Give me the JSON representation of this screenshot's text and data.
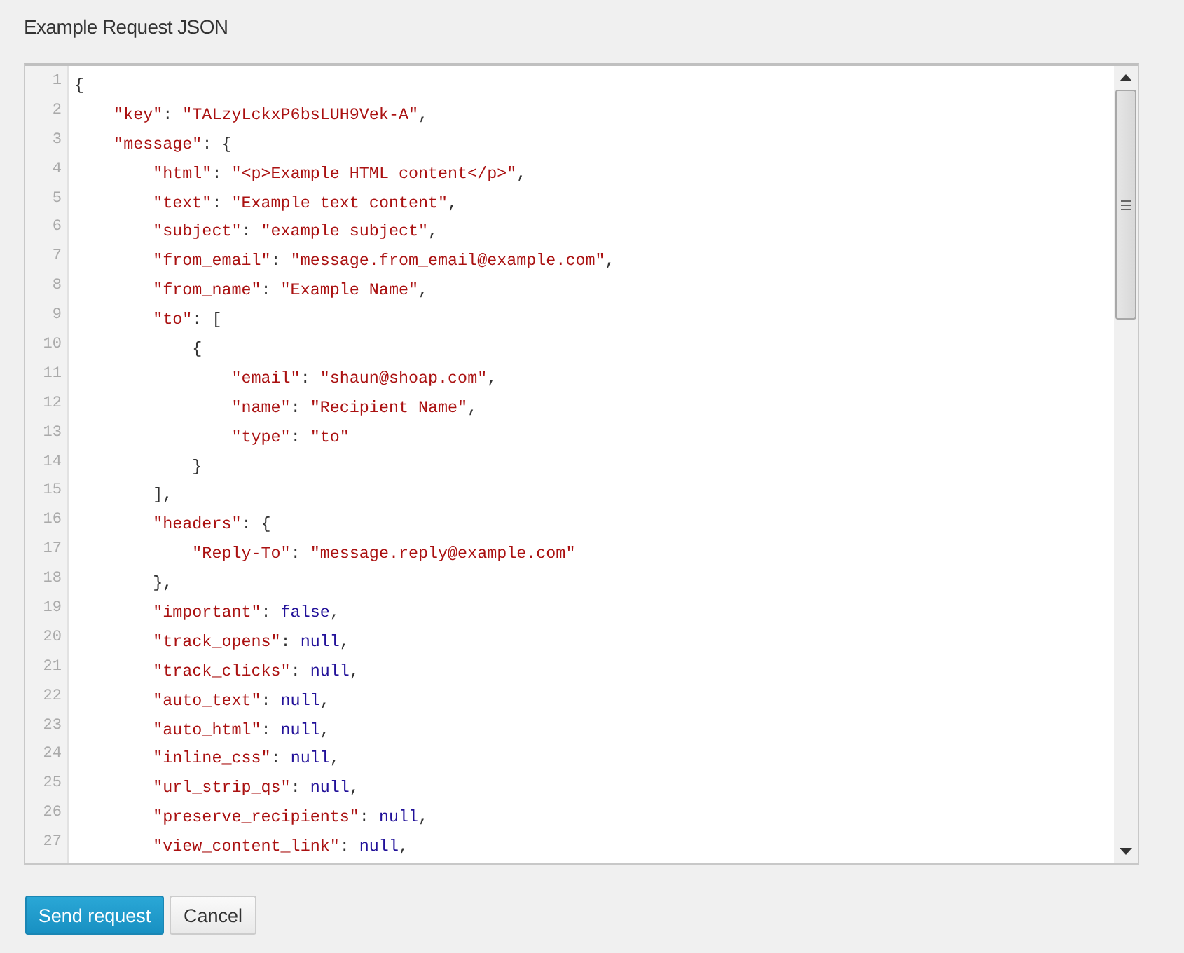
{
  "title": "Example Request JSON",
  "editor": {
    "lines": [
      {
        "number": "1",
        "tokens": [
          {
            "kind": "punct",
            "text": "{"
          }
        ]
      },
      {
        "number": "2",
        "tokens": [
          {
            "kind": "string",
            "text": "    \"key\""
          },
          {
            "kind": "punct",
            "text": ": "
          },
          {
            "kind": "string",
            "text": "\"TALzyLckxP6bsLUH9Vek-A\""
          },
          {
            "kind": "punct",
            "text": ","
          }
        ]
      },
      {
        "number": "3",
        "tokens": [
          {
            "kind": "string",
            "text": "    \"message\""
          },
          {
            "kind": "punct",
            "text": ": {"
          }
        ]
      },
      {
        "number": "4",
        "tokens": [
          {
            "kind": "string",
            "text": "        \"html\""
          },
          {
            "kind": "punct",
            "text": ": "
          },
          {
            "kind": "string",
            "text": "\"<p>Example HTML content</p>\""
          },
          {
            "kind": "punct",
            "text": ","
          }
        ]
      },
      {
        "number": "5",
        "tokens": [
          {
            "kind": "string",
            "text": "        \"text\""
          },
          {
            "kind": "punct",
            "text": ": "
          },
          {
            "kind": "string",
            "text": "\"Example text content\""
          },
          {
            "kind": "punct",
            "text": ","
          }
        ]
      },
      {
        "number": "6",
        "tokens": [
          {
            "kind": "string",
            "text": "        \"subject\""
          },
          {
            "kind": "punct",
            "text": ": "
          },
          {
            "kind": "string",
            "text": "\"example subject\""
          },
          {
            "kind": "punct",
            "text": ","
          }
        ]
      },
      {
        "number": "7",
        "tokens": [
          {
            "kind": "string",
            "text": "        \"from_email\""
          },
          {
            "kind": "punct",
            "text": ": "
          },
          {
            "kind": "string",
            "text": "\"message.from_email@example.com\""
          },
          {
            "kind": "punct",
            "text": ","
          }
        ]
      },
      {
        "number": "8",
        "tokens": [
          {
            "kind": "string",
            "text": "        \"from_name\""
          },
          {
            "kind": "punct",
            "text": ": "
          },
          {
            "kind": "string",
            "text": "\"Example Name\""
          },
          {
            "kind": "punct",
            "text": ","
          }
        ]
      },
      {
        "number": "9",
        "tokens": [
          {
            "kind": "string",
            "text": "        \"to\""
          },
          {
            "kind": "punct",
            "text": ": ["
          }
        ]
      },
      {
        "number": "10",
        "tokens": [
          {
            "kind": "punct",
            "text": "            {"
          }
        ]
      },
      {
        "number": "11",
        "tokens": [
          {
            "kind": "string",
            "text": "                \"email\""
          },
          {
            "kind": "punct",
            "text": ": "
          },
          {
            "kind": "string",
            "text": "\"shaun@shoap.com\""
          },
          {
            "kind": "punct",
            "text": ","
          }
        ]
      },
      {
        "number": "12",
        "tokens": [
          {
            "kind": "string",
            "text": "                \"name\""
          },
          {
            "kind": "punct",
            "text": ": "
          },
          {
            "kind": "string",
            "text": "\"Recipient Name\""
          },
          {
            "kind": "punct",
            "text": ","
          }
        ]
      },
      {
        "number": "13",
        "tokens": [
          {
            "kind": "string",
            "text": "                \"type\""
          },
          {
            "kind": "punct",
            "text": ": "
          },
          {
            "kind": "string",
            "text": "\"to\""
          }
        ]
      },
      {
        "number": "14",
        "tokens": [
          {
            "kind": "punct",
            "text": "            }"
          }
        ]
      },
      {
        "number": "15",
        "tokens": [
          {
            "kind": "punct",
            "text": "        ],"
          }
        ]
      },
      {
        "number": "16",
        "tokens": [
          {
            "kind": "string",
            "text": "        \"headers\""
          },
          {
            "kind": "punct",
            "text": ": {"
          }
        ]
      },
      {
        "number": "17",
        "tokens": [
          {
            "kind": "string",
            "text": "            \"Reply-To\""
          },
          {
            "kind": "punct",
            "text": ": "
          },
          {
            "kind": "string",
            "text": "\"message.reply@example.com\""
          }
        ]
      },
      {
        "number": "18",
        "tokens": [
          {
            "kind": "punct",
            "text": "        },"
          }
        ]
      },
      {
        "number": "19",
        "tokens": [
          {
            "kind": "string",
            "text": "        \"important\""
          },
          {
            "kind": "punct",
            "text": ": "
          },
          {
            "kind": "keyword",
            "text": "false"
          },
          {
            "kind": "punct",
            "text": ","
          }
        ]
      },
      {
        "number": "20",
        "tokens": [
          {
            "kind": "string",
            "text": "        \"track_opens\""
          },
          {
            "kind": "punct",
            "text": ": "
          },
          {
            "kind": "keyword",
            "text": "null"
          },
          {
            "kind": "punct",
            "text": ","
          }
        ]
      },
      {
        "number": "21",
        "tokens": [
          {
            "kind": "string",
            "text": "        \"track_clicks\""
          },
          {
            "kind": "punct",
            "text": ": "
          },
          {
            "kind": "keyword",
            "text": "null"
          },
          {
            "kind": "punct",
            "text": ","
          }
        ]
      },
      {
        "number": "22",
        "tokens": [
          {
            "kind": "string",
            "text": "        \"auto_text\""
          },
          {
            "kind": "punct",
            "text": ": "
          },
          {
            "kind": "keyword",
            "text": "null"
          },
          {
            "kind": "punct",
            "text": ","
          }
        ]
      },
      {
        "number": "23",
        "tokens": [
          {
            "kind": "string",
            "text": "        \"auto_html\""
          },
          {
            "kind": "punct",
            "text": ": "
          },
          {
            "kind": "keyword",
            "text": "null"
          },
          {
            "kind": "punct",
            "text": ","
          }
        ]
      },
      {
        "number": "24",
        "tokens": [
          {
            "kind": "string",
            "text": "        \"inline_css\""
          },
          {
            "kind": "punct",
            "text": ": "
          },
          {
            "kind": "keyword",
            "text": "null"
          },
          {
            "kind": "punct",
            "text": ","
          }
        ]
      },
      {
        "number": "25",
        "tokens": [
          {
            "kind": "string",
            "text": "        \"url_strip_qs\""
          },
          {
            "kind": "punct",
            "text": ": "
          },
          {
            "kind": "keyword",
            "text": "null"
          },
          {
            "kind": "punct",
            "text": ","
          }
        ]
      },
      {
        "number": "26",
        "tokens": [
          {
            "kind": "string",
            "text": "        \"preserve_recipients\""
          },
          {
            "kind": "punct",
            "text": ": "
          },
          {
            "kind": "keyword",
            "text": "null"
          },
          {
            "kind": "punct",
            "text": ","
          }
        ]
      },
      {
        "number": "27",
        "tokens": [
          {
            "kind": "string",
            "text": "        \"view_content_link\""
          },
          {
            "kind": "punct",
            "text": ": "
          },
          {
            "kind": "keyword",
            "text": "null"
          },
          {
            "kind": "punct",
            "text": ","
          }
        ]
      }
    ]
  },
  "buttons": [
    {
      "label": "Send request",
      "kind": "primary"
    },
    {
      "label": "Cancel",
      "kind": "secondary"
    }
  ]
}
